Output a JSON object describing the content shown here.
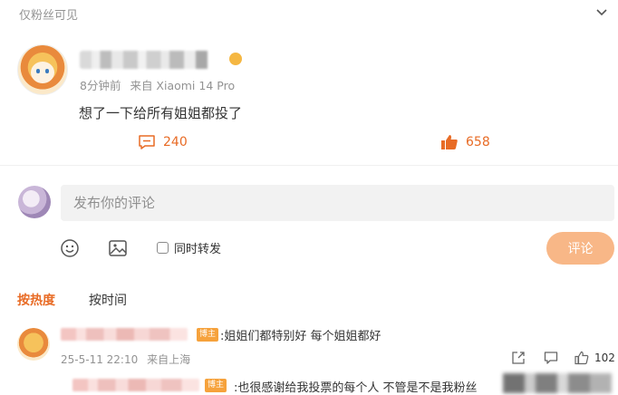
{
  "header": {
    "privacy_label": "仅粉丝可见"
  },
  "post": {
    "meta_time": "8分钟前",
    "meta_source": "来自 Xiaomi 14 Pro",
    "body": "想了一下给所有姐姐都投了",
    "comment_count": "240",
    "like_count": "658"
  },
  "composer": {
    "placeholder": "发布你的评论",
    "repost_label": "同时转发",
    "submit_label": "评论"
  },
  "sort": {
    "hot_label": "按热度",
    "time_label": "按时间"
  },
  "replies": [
    {
      "badge": "博主",
      "text": ":姐姐们都特别好  每个姐姐都好",
      "date": "25-5-11 22:10",
      "location": "来自上海",
      "like_count": "102"
    },
    {
      "badge": "博主",
      "text": ":也很感谢给我投票的每个人  不管是不是我粉丝"
    }
  ],
  "colors": {
    "accent": "#e86b25",
    "submit_bg": "#f8b787",
    "badge_bg": "#f6a23c",
    "muted": "#939393"
  }
}
